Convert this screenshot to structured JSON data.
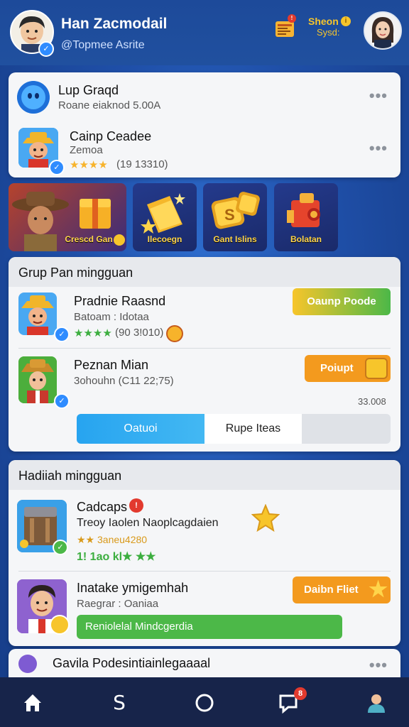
{
  "header": {
    "name": "Han Zacmodail",
    "handle": "@Topmee Asrite",
    "shop_label_1": "Sheon",
    "shop_label_2": "Sysd:"
  },
  "recent": {
    "item1": {
      "title": "Lup Graqd",
      "subtitle": "Roane eiaknod 5.00A"
    },
    "item2": {
      "title": "Cainp Ceadee",
      "subtitle": "Zemoa",
      "stars": "★★★★",
      "rating": "(19 13310)"
    }
  },
  "tiles": [
    {
      "label": "Crescd Gan"
    },
    {
      "label": "Ilecoegn"
    },
    {
      "label": "Gant Islins"
    },
    {
      "label": "Bolatan"
    }
  ],
  "group": {
    "title": "Grup Pan mingguan",
    "row1": {
      "title": "Pradnie Raasnd",
      "subtitle": "Batoam : Idotaa",
      "stars": "★★★★",
      "rating": "(90 3!010)",
      "button": "Oaunp Poode"
    },
    "row2": {
      "title": "Peznan Mian",
      "subtitle": "3ohouhn (C11 22;75)",
      "button": "Poiupt"
    },
    "count": "33.008",
    "tab_active": "Oatuoi",
    "tab_inactive": "Rupe Iteas"
  },
  "hadiah": {
    "title": "Hadiiah mingguan",
    "row1": {
      "title": "Cadcaps",
      "line2": "Treoy Iaolen Naoplcagdaien",
      "line3": "★★ 3aneu4280",
      "line4": "1! 1ao kl★ ★★"
    },
    "row2": {
      "title": "Inatake ymigemhah",
      "subtitle": "Raegrar : Oaniaa",
      "button": "Daibn Fliet",
      "green_button": "Reniolelal Mindcgerdia"
    }
  },
  "next_card": {
    "title": "Gavila Podesintiainlegaaaal"
  },
  "nav": {
    "badge": "8",
    "tab2_glyph": "S"
  },
  "colors": {
    "green": "#4cb848",
    "orange": "#f39a1e",
    "blue_tab": "#2fa7ee",
    "accent_yellow": "#f7c52b"
  }
}
